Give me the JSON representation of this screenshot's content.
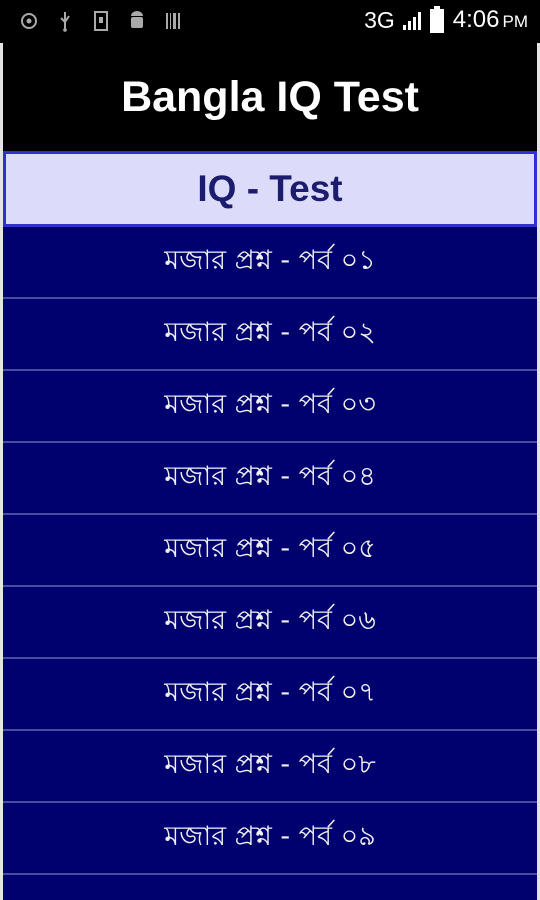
{
  "status_bar": {
    "network": "3G",
    "time": "4:06",
    "ampm": "PM",
    "left_icons": [
      "chrome-icon",
      "usb-icon",
      "sim-icon",
      "android-icon",
      "barcode-icon"
    ],
    "right_icons": [
      "signal-icon",
      "battery-icon"
    ]
  },
  "app": {
    "title": "Bangla IQ Test",
    "section_header": "IQ - Test",
    "items": [
      {
        "label": "মজার প্রশ্ন - পর্ব ০১"
      },
      {
        "label": "মজার প্রশ্ন - পর্ব ০২"
      },
      {
        "label": "মজার প্রশ্ন - পর্ব ০৩"
      },
      {
        "label": "মজার প্রশ্ন - পর্ব ০৪"
      },
      {
        "label": "মজার প্রশ্ন - পর্ব ০৫"
      },
      {
        "label": "মজার প্রশ্ন - পর্ব ০৬"
      },
      {
        "label": "মজার প্রশ্ন - পর্ব ০৭"
      },
      {
        "label": "মজার প্রশ্ন - পর্ব ০৮"
      },
      {
        "label": "মজার প্রশ্ন - পর্ব ০৯"
      }
    ]
  },
  "colors": {
    "title_bg": "#000000",
    "list_bg": "#00006e",
    "header_bg": "#dcdcfa",
    "header_border": "#3030d0"
  }
}
